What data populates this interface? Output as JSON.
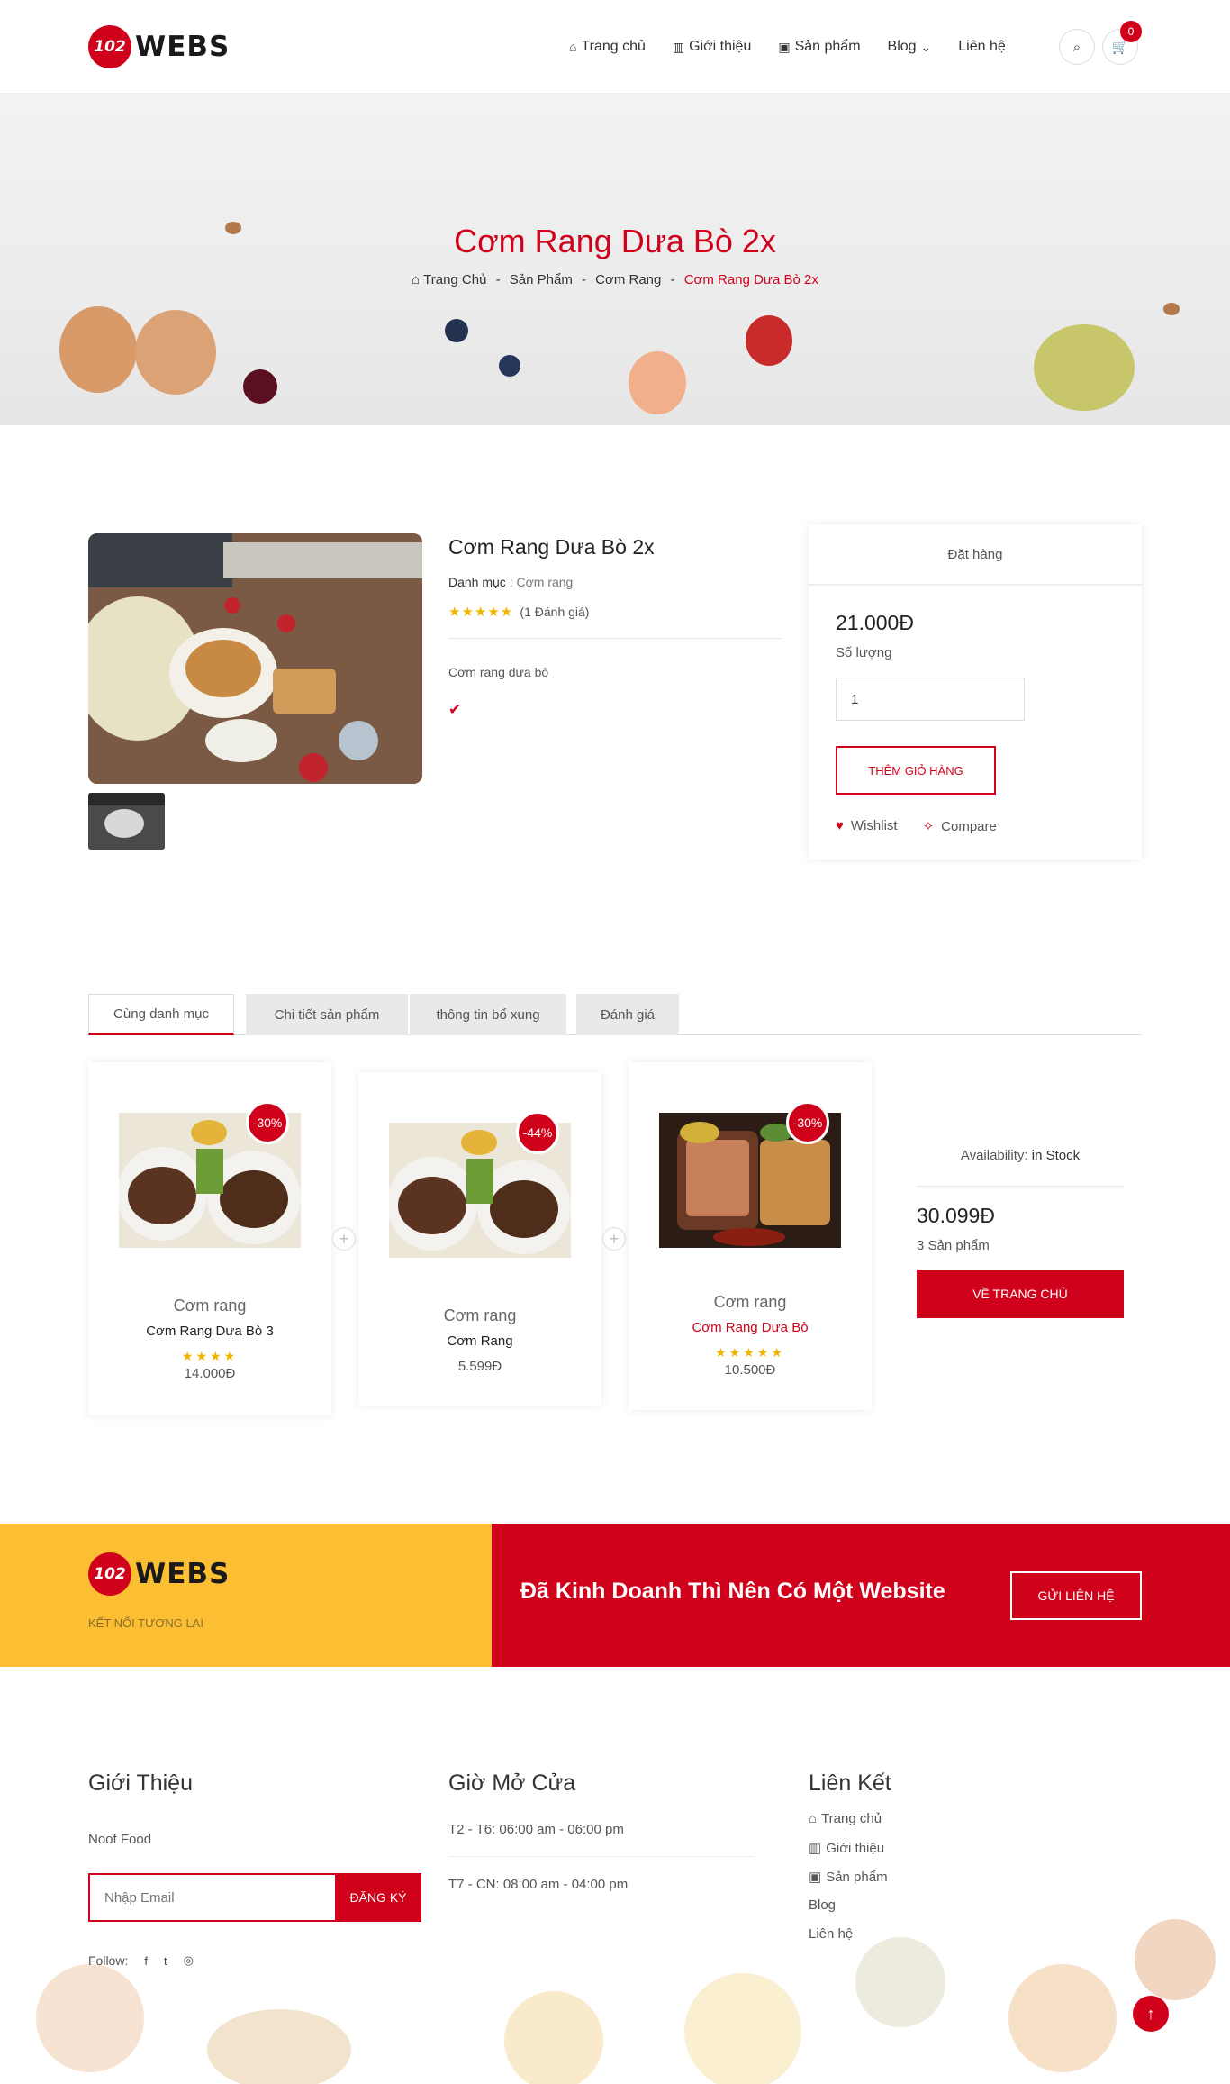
{
  "brand": {
    "logo_badge": "102",
    "logo_text": "WEBS",
    "tagline": "KẾT NỐI TƯƠNG LAI"
  },
  "nav": {
    "items": [
      {
        "label": "Trang chủ",
        "icon": "home-icon"
      },
      {
        "label": "Giới thiệu",
        "icon": "building-icon"
      },
      {
        "label": "Sản phẩm",
        "icon": "shopping-bag-icon"
      },
      {
        "label": "Blog",
        "icon": "chevron-down-icon"
      },
      {
        "label": "Liên hệ",
        "icon": ""
      }
    ],
    "cart_count": "0"
  },
  "banner": {
    "title": "Cơm Rang Dưa Bò 2x",
    "breadcrumb": [
      "Trang Chủ",
      "Sản Phẩm",
      "Cơm Rang",
      "Cơm Rang Dưa Bò 2x"
    ]
  },
  "product": {
    "title": "Cơm Rang Dưa Bò 2x",
    "category_label": "Danh mục :",
    "category_value": "Cơm rang",
    "stars": "★★★★★",
    "rating_count": "(1 Đánh giá)",
    "description": "Cơm rang dưa bò",
    "check_icon": "✔"
  },
  "order": {
    "header": "Đặt hàng",
    "price": "21.000Đ",
    "qty_label": "Số lượng",
    "qty_value": "1",
    "add_button": "THÊM GIỎ HÀNG",
    "wishlist": "Wishlist",
    "compare": "Compare"
  },
  "tabs": [
    "Cùng danh mục",
    "Chi tiết sản phẩm",
    "thông tin bổ xung",
    "Đánh giá"
  ],
  "related": [
    {
      "discount": "-30%",
      "category": "Cơm rang",
      "name": "Cơm Rang Dưa Bò 3",
      "stars": "★★★★",
      "price": "14.000Đ"
    },
    {
      "discount": "-44%",
      "category": "Cơm rang",
      "name": "Cơm Rang",
      "stars": "",
      "price": "5.599Đ"
    },
    {
      "discount": "-30%",
      "category": "Cơm rang",
      "name": "Cơm Rang Dưa Bò",
      "stars": "★★★★★",
      "price": "10.500Đ"
    }
  ],
  "side": {
    "availability_label": "Availability:",
    "availability_value": "in Stock",
    "price": "30.099Đ",
    "count": "3 Sản phẩm",
    "button": "VỀ TRANG CHỦ"
  },
  "cta": {
    "text": "Đã Kinh Doanh Thì Nên Có Một Website",
    "button": "GỬI LIÊN HỆ"
  },
  "footer": {
    "about": {
      "title": "Giới Thiệu",
      "text": "Noof Food",
      "email_placeholder": "Nhập Email",
      "subscribe": "ĐĂNG KÝ",
      "follow": "Follow:"
    },
    "hours": {
      "title": "Giờ Mở Cửa",
      "row1": "T2 - T6: 06:00 am - 06:00 pm",
      "row2": "T7 - CN: 08:00 am - 04:00 pm"
    },
    "links": {
      "title": "Liên Kết",
      "items": [
        "Trang chủ",
        "Giới thiệu",
        "Sản phẩm",
        "Blog",
        "Liên hệ"
      ]
    }
  },
  "colors": {
    "accent": "#d0021b",
    "yellow": "#fcbf34",
    "star": "#f0b400"
  }
}
